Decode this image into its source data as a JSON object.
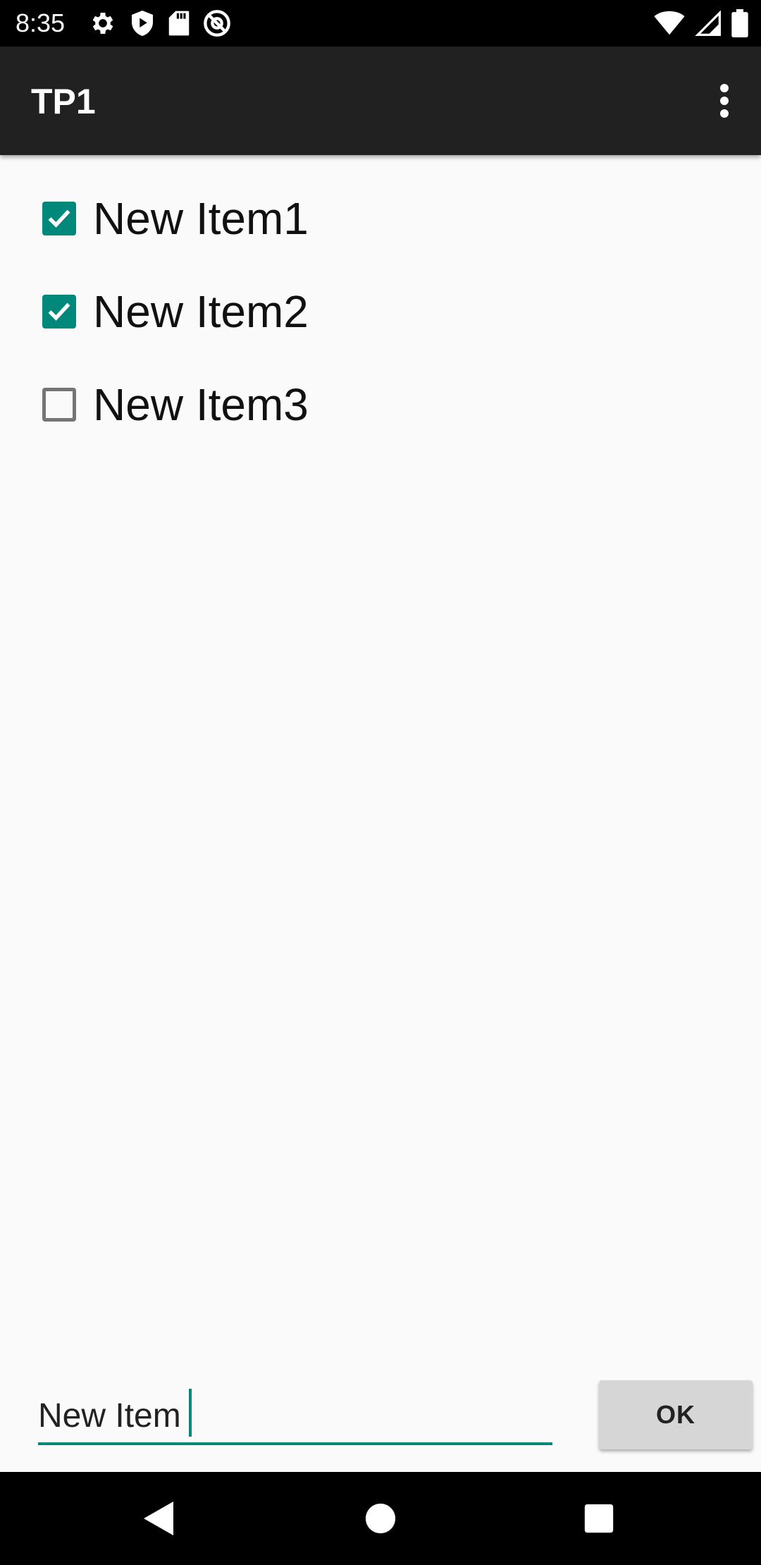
{
  "status_bar": {
    "time": "8:35",
    "left_icons": [
      "gear-icon",
      "shield-play-icon",
      "sd-card-icon",
      "at-sign-icon"
    ],
    "right_icons": [
      "wifi-icon",
      "cell-signal-icon",
      "battery-icon"
    ]
  },
  "app_bar": {
    "title": "TP1",
    "menu_icon": "overflow-menu-icon"
  },
  "items": [
    {
      "label": "New Item1",
      "checked": true
    },
    {
      "label": "New Item2",
      "checked": true
    },
    {
      "label": "New Item3",
      "checked": false
    }
  ],
  "input": {
    "value": "New Item"
  },
  "ok_button": {
    "label": "OK"
  },
  "nav_bar": {
    "icons": [
      "back-icon",
      "home-icon",
      "recents-icon"
    ]
  },
  "colors": {
    "accent": "#00897b",
    "app_bar": "#212121",
    "background": "#fafafa"
  }
}
